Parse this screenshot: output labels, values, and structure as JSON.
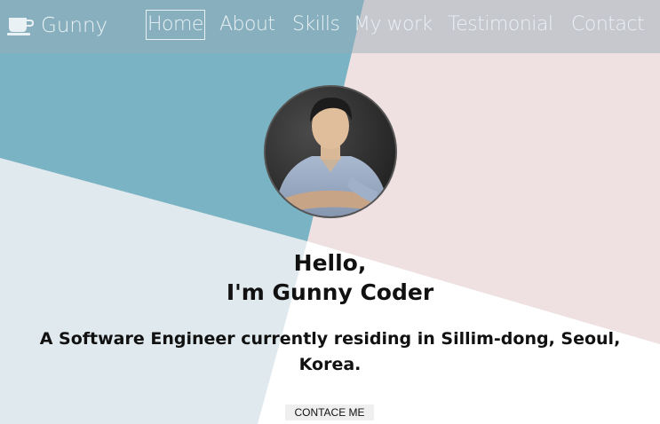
{
  "nav": {
    "brand_name": "Gunny",
    "brand_icon": "coffee-cup-icon",
    "links": [
      {
        "label": "Home",
        "active": true
      },
      {
        "label": "About",
        "active": false
      },
      {
        "label": "Skills",
        "active": false
      },
      {
        "label": "My work",
        "active": false
      },
      {
        "label": "Testimonial",
        "active": false
      },
      {
        "label": "Contact",
        "active": false
      }
    ]
  },
  "hero": {
    "greeting_line1": "Hello,",
    "greeting_line2": "I'm Gunny Coder",
    "tagline": "A Software Engineer currently residing in Sillim-dong, Seoul, Korea.",
    "cta_label": "CONTACE ME",
    "avatar": "profile-photo"
  },
  "colors": {
    "teal": "#7ab3c3",
    "pink": "#efe0e1",
    "light_blue": "#e0e9ed",
    "white": "#ffffff",
    "nav_text": "#e9f1f5"
  }
}
